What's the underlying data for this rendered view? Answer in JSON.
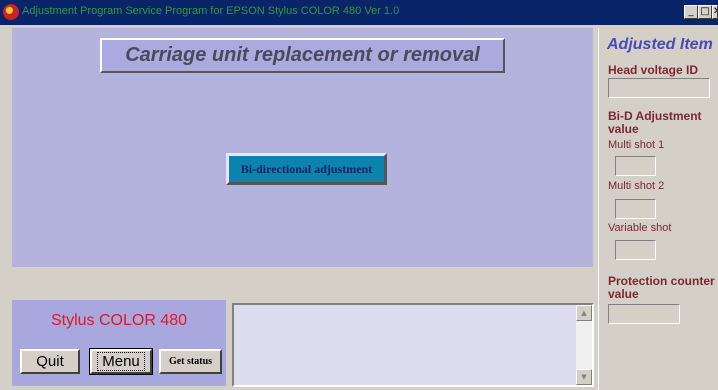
{
  "window": {
    "title": "Adjustment Program Service Program for EPSON Stylus COLOR 480 Ver 1.0"
  },
  "main": {
    "header": "Carriage unit replacement or removal",
    "bid_button": "Bi-directional adjustment"
  },
  "bottom": {
    "model": "Stylus COLOR 480",
    "quit": "Quit",
    "menu": "Menu",
    "get_status": "Get status",
    "log_text": ""
  },
  "side": {
    "title": "Adjusted Item",
    "head_voltage_label": "Head voltage ID",
    "bid_label": "Bi-D Adjustment value",
    "multi1_label": "Multi shot 1",
    "multi2_label": "Multi shot 2",
    "variable_label": "Variable shot",
    "protection_label": "Protection counter value",
    "head_voltage_value": "",
    "multi1_value": "",
    "multi2_value": "",
    "variable_value": "",
    "protection_value": ""
  },
  "colors": {
    "titlebar": "#0a246a",
    "panel": "#b3b3de",
    "bid_button": "#0d84ad",
    "model_text": "#e0191e",
    "side_label": "#7d2732",
    "side_title": "#4b4bb5"
  }
}
